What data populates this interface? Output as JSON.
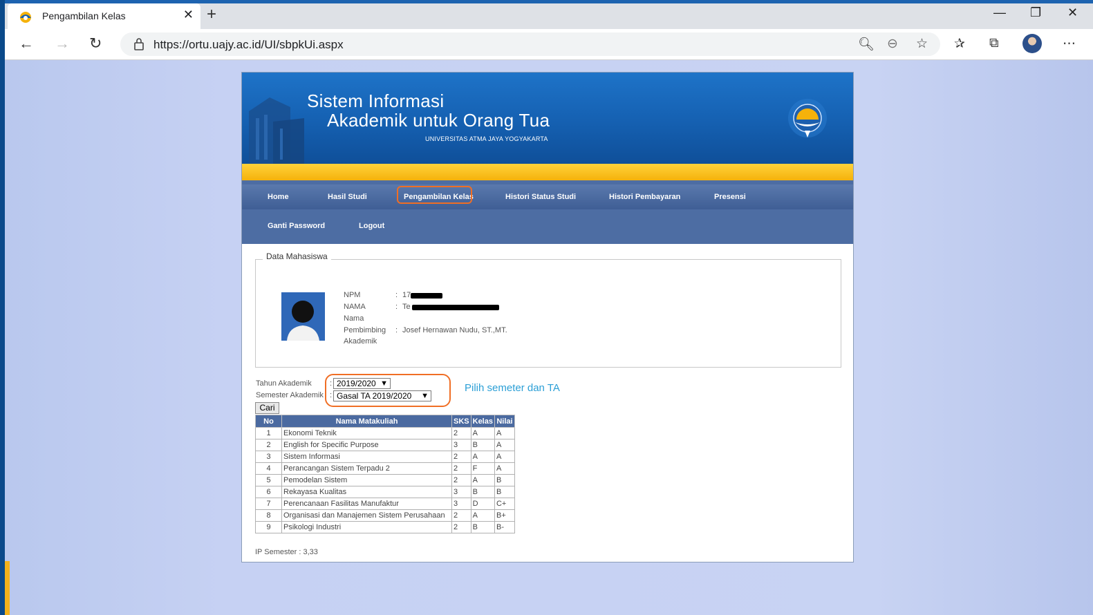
{
  "browser": {
    "tab_title": "Pengambilan Kelas",
    "url": "https://ortu.uajy.ac.id/UI/sbpkUi.aspx"
  },
  "banner": {
    "title_line1": "Sistem Informasi",
    "title_line2": "Akademik untuk Orang Tua",
    "subtitle": "UNIVERSITAS ATMA JAYA YOGYAKARTA"
  },
  "menu": {
    "row1": [
      "Home",
      "Hasil Studi",
      "Pengambilan Kelas",
      "Histori Status Studi",
      "Histori Pembayaran",
      "Presensi"
    ],
    "row2": [
      "Ganti Password",
      "Logout"
    ]
  },
  "student": {
    "legend": "Data Mahasiswa",
    "npm_label": "NPM",
    "npm_value": "17",
    "nama_label": "NAMA",
    "nama_value": "Te",
    "nama2_label": "Nama",
    "pembimbing_label1": "Pembimbing",
    "pembimbing_label2": "Akademik",
    "pembimbing_value": "Josef Hernawan Nudu, ST.,MT.",
    "sep": ":"
  },
  "filter": {
    "tahun_label": "Tahun Akademik",
    "tahun_value": "2019/2020",
    "semester_label": "Semester Akademik",
    "semester_value": "Gasal TA 2019/2020",
    "sep": ":",
    "search_button": "Cari",
    "hint": "Pilih semeter dan TA"
  },
  "table": {
    "headers": [
      "No",
      "Nama Matakuliah",
      "SKS",
      "Kelas",
      "Nilai"
    ],
    "rows": [
      [
        "1",
        "Ekonomi Teknik",
        "2",
        "A",
        "A"
      ],
      [
        "2",
        "English for Specific Purpose",
        "3",
        "B",
        "A"
      ],
      [
        "3",
        "Sistem Informasi",
        "2",
        "A",
        "A"
      ],
      [
        "4",
        "Perancangan Sistem Terpadu 2",
        "2",
        "F",
        "A"
      ],
      [
        "5",
        "Pemodelan Sistem",
        "2",
        "A",
        "B"
      ],
      [
        "6",
        "Rekayasa Kualitas",
        "3",
        "B",
        "B"
      ],
      [
        "7",
        "Perencanaan Fasilitas Manufaktur",
        "3",
        "D",
        "C+"
      ],
      [
        "8",
        "Organisasi dan Manajemen Sistem Perusahaan",
        "2",
        "A",
        "B+"
      ],
      [
        "9",
        "Psikologi Industri",
        "2",
        "B",
        "B-"
      ]
    ]
  },
  "ip_semester": "IP Semester : 3,33",
  "icons": [
    "favicon",
    "close-icon",
    "plus-icon",
    "minimize-icon",
    "restore-icon",
    "window-close-icon",
    "back-arrow-icon",
    "forward-arrow-icon",
    "refresh-icon",
    "lock-icon",
    "search-page-icon",
    "zoom-out-icon",
    "star-icon",
    "favorites-icon",
    "collections-icon",
    "more-icon"
  ],
  "colors": {
    "menu": "#4d6da3",
    "banner": "#1560b1",
    "gold": "#f5b20b",
    "highlight": "#f06e24",
    "hint": "#2b9fd6"
  }
}
